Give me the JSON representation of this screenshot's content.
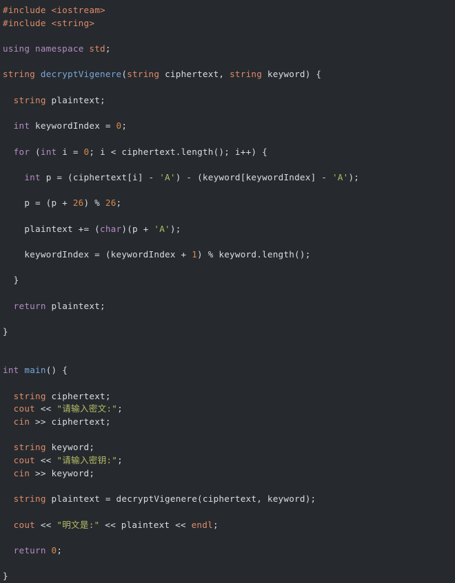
{
  "editor": {
    "language": "C++",
    "background_color": "#262a2e",
    "theme": "dark",
    "colors": {
      "plain": "#d8dee3",
      "keyword": "#b58bc4",
      "type": "#e08b6a",
      "function": "#7aa6da",
      "number": "#d98b4f",
      "string": "#b5bd68",
      "preprocessor": "#e08b6a"
    }
  },
  "code": {
    "lines": [
      {
        "tokens": [
          {
            "t": "#include ",
            "c": "pre"
          },
          {
            "t": "<iostream>",
            "c": "prearg"
          }
        ]
      },
      {
        "tokens": [
          {
            "t": "#include ",
            "c": "pre"
          },
          {
            "t": "<string>",
            "c": "prearg"
          }
        ]
      },
      {
        "tokens": []
      },
      {
        "tokens": [
          {
            "t": "using",
            "c": "kw"
          },
          {
            "t": " ",
            "c": "plain"
          },
          {
            "t": "namespace",
            "c": "kw"
          },
          {
            "t": " ",
            "c": "plain"
          },
          {
            "t": "std",
            "c": "type"
          },
          {
            "t": ";",
            "c": "punct"
          }
        ]
      },
      {
        "tokens": []
      },
      {
        "tokens": [
          {
            "t": "string",
            "c": "type"
          },
          {
            "t": " ",
            "c": "plain"
          },
          {
            "t": "decryptVigenere",
            "c": "fn"
          },
          {
            "t": "(",
            "c": "punct"
          },
          {
            "t": "string",
            "c": "type"
          },
          {
            "t": " ciphertext, ",
            "c": "plain"
          },
          {
            "t": "string",
            "c": "type"
          },
          {
            "t": " keyword) {",
            "c": "plain"
          }
        ]
      },
      {
        "tokens": []
      },
      {
        "tokens": [
          {
            "t": "  ",
            "c": "plain"
          },
          {
            "t": "string",
            "c": "type"
          },
          {
            "t": " plaintext;",
            "c": "plain"
          }
        ]
      },
      {
        "tokens": []
      },
      {
        "tokens": [
          {
            "t": "  ",
            "c": "plain"
          },
          {
            "t": "int",
            "c": "kw"
          },
          {
            "t": " keywordIndex = ",
            "c": "plain"
          },
          {
            "t": "0",
            "c": "num"
          },
          {
            "t": ";",
            "c": "punct"
          }
        ]
      },
      {
        "tokens": []
      },
      {
        "tokens": [
          {
            "t": "  ",
            "c": "plain"
          },
          {
            "t": "for",
            "c": "kw"
          },
          {
            "t": " (",
            "c": "plain"
          },
          {
            "t": "int",
            "c": "kw"
          },
          {
            "t": " i = ",
            "c": "plain"
          },
          {
            "t": "0",
            "c": "num"
          },
          {
            "t": "; i < ciphertext.length(); i++) {",
            "c": "plain"
          }
        ]
      },
      {
        "tokens": []
      },
      {
        "tokens": [
          {
            "t": "    ",
            "c": "plain"
          },
          {
            "t": "int",
            "c": "kw"
          },
          {
            "t": " p = (ciphertext[i] - ",
            "c": "plain"
          },
          {
            "t": "'A'",
            "c": "str"
          },
          {
            "t": ") - (keyword[keywordIndex] - ",
            "c": "plain"
          },
          {
            "t": "'A'",
            "c": "str"
          },
          {
            "t": ");",
            "c": "plain"
          }
        ]
      },
      {
        "tokens": []
      },
      {
        "tokens": [
          {
            "t": "    p = (p + ",
            "c": "plain"
          },
          {
            "t": "26",
            "c": "num"
          },
          {
            "t": ") % ",
            "c": "plain"
          },
          {
            "t": "26",
            "c": "num"
          },
          {
            "t": ";",
            "c": "punct"
          }
        ]
      },
      {
        "tokens": []
      },
      {
        "tokens": [
          {
            "t": "    plaintext += (",
            "c": "plain"
          },
          {
            "t": "char",
            "c": "kw"
          },
          {
            "t": ")(p + ",
            "c": "plain"
          },
          {
            "t": "'A'",
            "c": "str"
          },
          {
            "t": ");",
            "c": "plain"
          }
        ]
      },
      {
        "tokens": []
      },
      {
        "tokens": [
          {
            "t": "    keywordIndex = (keywordIndex + ",
            "c": "plain"
          },
          {
            "t": "1",
            "c": "num"
          },
          {
            "t": ") % keyword.length();",
            "c": "plain"
          }
        ]
      },
      {
        "tokens": []
      },
      {
        "tokens": [
          {
            "t": "  }",
            "c": "plain"
          }
        ]
      },
      {
        "tokens": []
      },
      {
        "tokens": [
          {
            "t": "  ",
            "c": "plain"
          },
          {
            "t": "return",
            "c": "kw"
          },
          {
            "t": " plaintext;",
            "c": "plain"
          }
        ]
      },
      {
        "tokens": []
      },
      {
        "tokens": [
          {
            "t": "}",
            "c": "plain"
          }
        ]
      },
      {
        "tokens": []
      },
      {
        "tokens": []
      },
      {
        "tokens": [
          {
            "t": "int",
            "c": "kw"
          },
          {
            "t": " ",
            "c": "plain"
          },
          {
            "t": "main",
            "c": "fn"
          },
          {
            "t": "() {",
            "c": "plain"
          }
        ]
      },
      {
        "tokens": []
      },
      {
        "tokens": [
          {
            "t": "  ",
            "c": "plain"
          },
          {
            "t": "string",
            "c": "type"
          },
          {
            "t": " ciphertext;",
            "c": "plain"
          }
        ]
      },
      {
        "tokens": [
          {
            "t": "  ",
            "c": "plain"
          },
          {
            "t": "cout",
            "c": "type"
          },
          {
            "t": " << ",
            "c": "plain"
          },
          {
            "t": "\"请输入密文:\"",
            "c": "str"
          },
          {
            "t": ";",
            "c": "punct"
          }
        ]
      },
      {
        "tokens": [
          {
            "t": "  ",
            "c": "plain"
          },
          {
            "t": "cin",
            "c": "type"
          },
          {
            "t": " >> ciphertext;",
            "c": "plain"
          }
        ]
      },
      {
        "tokens": []
      },
      {
        "tokens": [
          {
            "t": "  ",
            "c": "plain"
          },
          {
            "t": "string",
            "c": "type"
          },
          {
            "t": " keyword;",
            "c": "plain"
          }
        ]
      },
      {
        "tokens": [
          {
            "t": "  ",
            "c": "plain"
          },
          {
            "t": "cout",
            "c": "type"
          },
          {
            "t": " << ",
            "c": "plain"
          },
          {
            "t": "\"请输入密钥:\"",
            "c": "str"
          },
          {
            "t": ";",
            "c": "punct"
          }
        ]
      },
      {
        "tokens": [
          {
            "t": "  ",
            "c": "plain"
          },
          {
            "t": "cin",
            "c": "type"
          },
          {
            "t": " >> keyword;",
            "c": "plain"
          }
        ]
      },
      {
        "tokens": []
      },
      {
        "tokens": [
          {
            "t": "  ",
            "c": "plain"
          },
          {
            "t": "string",
            "c": "type"
          },
          {
            "t": " plaintext = decryptVigenere(ciphertext, keyword);",
            "c": "plain"
          }
        ]
      },
      {
        "tokens": []
      },
      {
        "tokens": [
          {
            "t": "  ",
            "c": "plain"
          },
          {
            "t": "cout",
            "c": "type"
          },
          {
            "t": " << ",
            "c": "plain"
          },
          {
            "t": "\"明文是:\"",
            "c": "str"
          },
          {
            "t": " << plaintext << ",
            "c": "plain"
          },
          {
            "t": "endl",
            "c": "type"
          },
          {
            "t": ";",
            "c": "punct"
          }
        ]
      },
      {
        "tokens": []
      },
      {
        "tokens": [
          {
            "t": "  ",
            "c": "plain"
          },
          {
            "t": "return",
            "c": "kw"
          },
          {
            "t": " ",
            "c": "plain"
          },
          {
            "t": "0",
            "c": "num"
          },
          {
            "t": ";",
            "c": "punct"
          }
        ]
      },
      {
        "tokens": []
      },
      {
        "tokens": [
          {
            "t": "}",
            "c": "plain"
          }
        ]
      }
    ]
  }
}
